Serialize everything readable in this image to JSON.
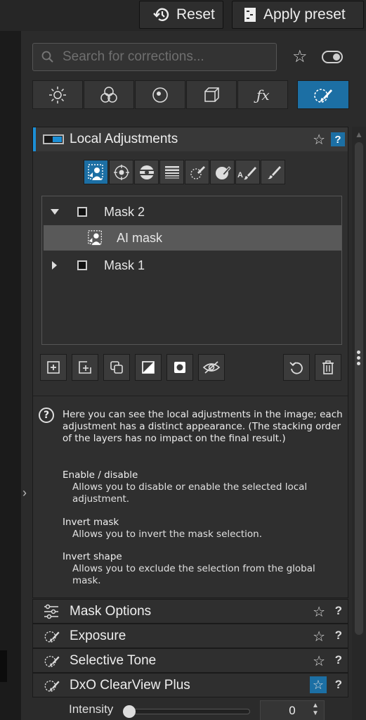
{
  "header": {
    "reset_label": "Reset",
    "apply_preset_label": "Apply preset"
  },
  "search": {
    "placeholder": "Search for corrections..."
  },
  "category_tabs": [
    {
      "icon": "sun-icon"
    },
    {
      "icon": "circles-icon"
    },
    {
      "icon": "lens-icon"
    },
    {
      "icon": "cube-icon"
    },
    {
      "icon": "fx-icon"
    },
    {
      "icon": "local-brush-icon",
      "active": true
    }
  ],
  "local_adjustments": {
    "title": "Local Adjustments",
    "help": "?",
    "tools": [
      {
        "icon": "ai-mask-icon",
        "active": true
      },
      {
        "icon": "control-point-icon"
      },
      {
        "icon": "control-line-icon"
      },
      {
        "icon": "graduated-filter-icon"
      },
      {
        "icon": "eraser-icon"
      },
      {
        "icon": "auto-brush-icon"
      },
      {
        "icon": "a-brush-icon",
        "letter": "A"
      },
      {
        "icon": "brush-icon"
      }
    ],
    "masks": [
      {
        "label": "Mask 2",
        "expanded": true
      },
      {
        "label": "AI mask",
        "selected": true
      },
      {
        "label": "Mask 1",
        "expanded": false
      }
    ],
    "actions": [
      "add-icon",
      "add-mask-icon",
      "duplicate-icon",
      "invert-mask-icon",
      "invert-shape-icon",
      "visibility-icon"
    ],
    "help_text": {
      "intro": "Here you can see the local adjustments in the image; each adjustment has a distinct appearance. (The stacking order of the layers has no impact on the final result.)",
      "items": [
        {
          "title": "Enable / disable",
          "desc": "Allows you to disable or enable the selected local adjustment."
        },
        {
          "title": "Invert mask",
          "desc": "Allows you to invert the mask selection."
        },
        {
          "title": "Invert shape",
          "desc": "Allows you to exclude the selection from the global mask."
        }
      ]
    }
  },
  "sections": [
    {
      "label": "Mask Options",
      "icon": "sliders-icon"
    },
    {
      "label": "Exposure",
      "icon": "local-brush-icon"
    },
    {
      "label": "Selective Tone",
      "icon": "local-brush-icon"
    },
    {
      "label": "DxO ClearView Plus",
      "icon": "local-brush-icon",
      "star_active": true
    }
  ],
  "intensity": {
    "label": "Intensity",
    "value": "0",
    "slider_fraction": 0
  },
  "colors": {
    "accent": "#1c6fa4",
    "accent_bright": "#1c8fd6"
  }
}
